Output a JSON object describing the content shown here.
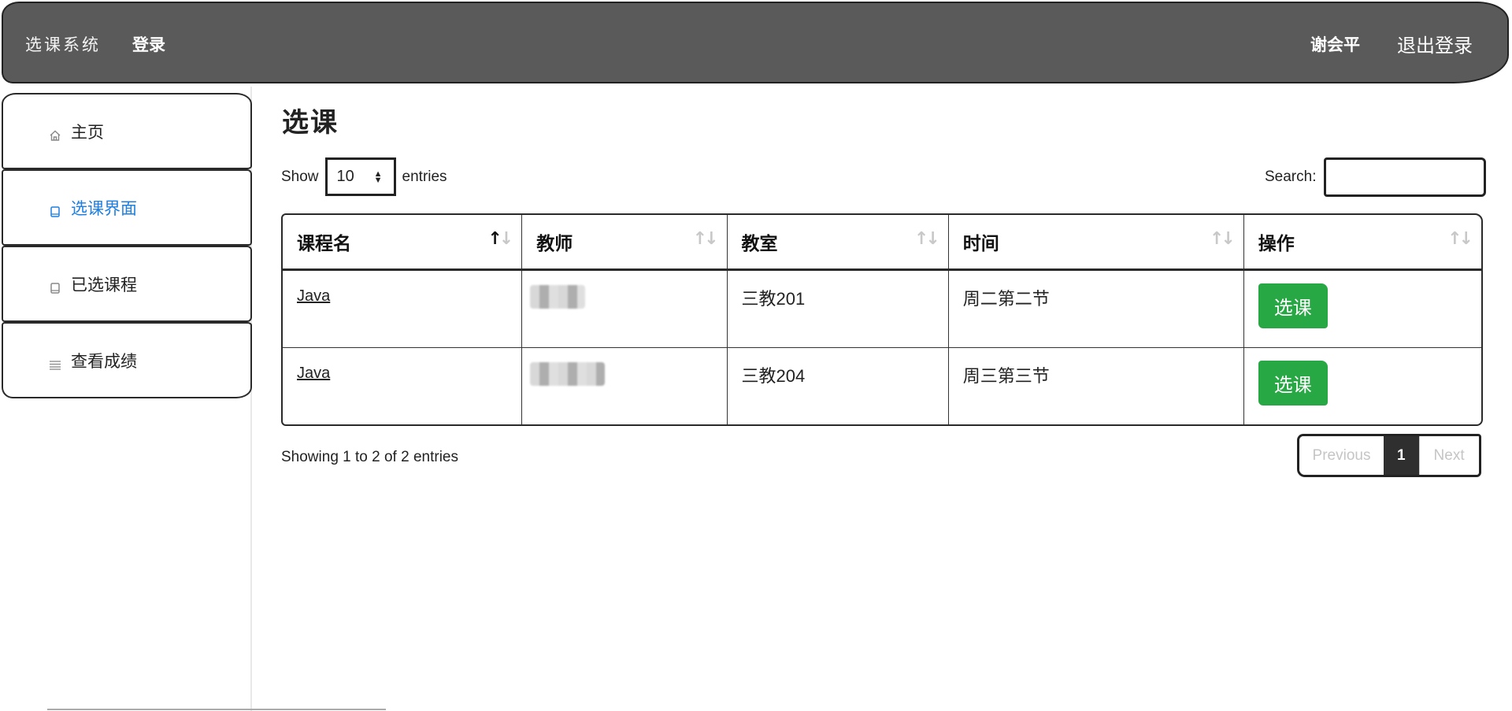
{
  "navbar": {
    "brand": "选课系统",
    "login": "登录",
    "user": "谢会平",
    "logout": "退出登录"
  },
  "sidebar": {
    "items": [
      {
        "label": "主页",
        "icon": "home-icon"
      },
      {
        "label": "选课界面",
        "icon": "book-icon",
        "active": true
      },
      {
        "label": "已选课程",
        "icon": "book-icon"
      },
      {
        "label": "查看成绩",
        "icon": "list-icon"
      }
    ]
  },
  "page": {
    "title": "选课"
  },
  "controls": {
    "show_label": "Show",
    "length_value": "10",
    "entries_label": "entries",
    "search_label": "Search:",
    "search_value": ""
  },
  "table": {
    "columns": [
      "课程名",
      "教师",
      "教室",
      "时间",
      "操作"
    ],
    "rows": [
      {
        "course": "Java",
        "teacher": "",
        "room": "三教201",
        "time": "周二第二节",
        "action": "选课"
      },
      {
        "course": "Java",
        "teacher": "",
        "room": "三教204",
        "time": "周三第三节",
        "action": "选课"
      }
    ]
  },
  "footer": {
    "info": "Showing 1 to 2 of 2 entries",
    "previous": "Previous",
    "current_page": "1",
    "next": "Next"
  },
  "colors": {
    "navbar_bg": "#5a5a5a",
    "active_link": "#1e7fe0",
    "select_button": "#28a745",
    "current_page_bg": "#2f2f2f"
  }
}
